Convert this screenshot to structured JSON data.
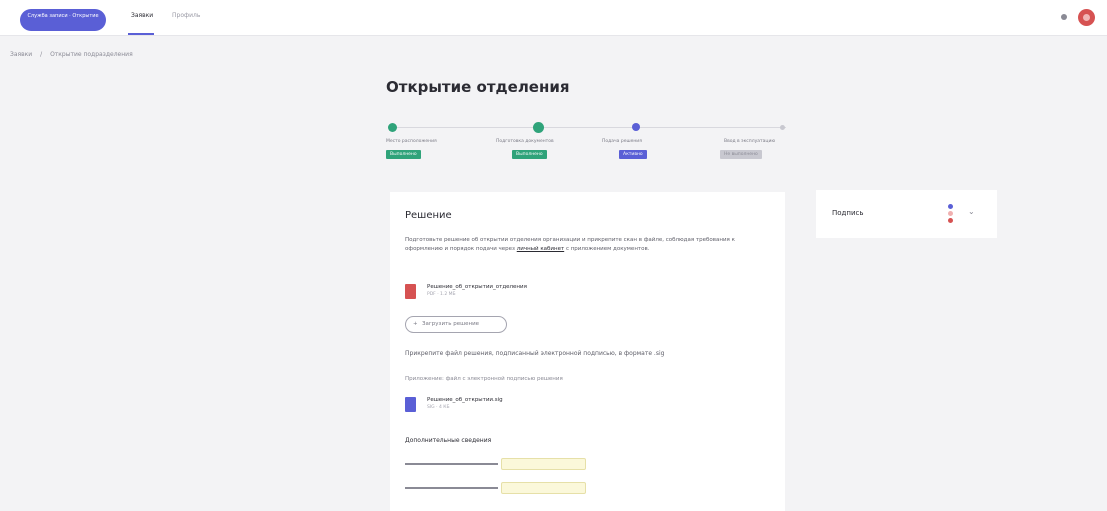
{
  "header": {
    "logo_text": "Служба записи · Открытие",
    "tabs": [
      {
        "label": "Заявки",
        "active": true
      },
      {
        "label": "Профиль",
        "active": false
      }
    ],
    "accent_color": "#5a5fd6"
  },
  "breadcrumb": [
    "Заявки",
    "Открытие подразделения"
  ],
  "page_title": "Открытие отделения",
  "stepper": [
    {
      "label": "Место расположения",
      "status": "Выполнено",
      "color": "#2fa37a"
    },
    {
      "label": "Подготовка документов",
      "status": "Выполнено",
      "color": "#2fa37a"
    },
    {
      "label": "Подача решения",
      "status": "Активно",
      "color": "#5a5fd6"
    },
    {
      "label": "Ввод в эксплуатацию",
      "status": "Не выполнено",
      "color": "#c8c8d0"
    }
  ],
  "main_card": {
    "title": "Решение",
    "description": "Подготовьте решение об открытии отделения организации и прикрепите скан в файле, соблюдая требования к оформлению и порядок подачи через",
    "description_link": "личный кабинет",
    "description_end": "с приложением документов.",
    "file1": {
      "name": "Решение_об_открытии_отделения",
      "meta": "PDF · 1.2 МБ",
      "icon": "pdf-file-icon",
      "color": "#d65252"
    },
    "add_button": "Загрузить решение",
    "instruction": "Прикрепите файл решения, подписанный электронной подписью, в формате .sig",
    "hint": "Приложение: файл с электронной подписью решения",
    "file2": {
      "name": "Решение_об_открытии.sig",
      "meta": "SIG · 4 КБ",
      "icon": "doc-file-icon",
      "color": "#5a5fd6"
    },
    "section_label": "Дополнительные сведения"
  },
  "side_card": {
    "label": "Подпись"
  }
}
